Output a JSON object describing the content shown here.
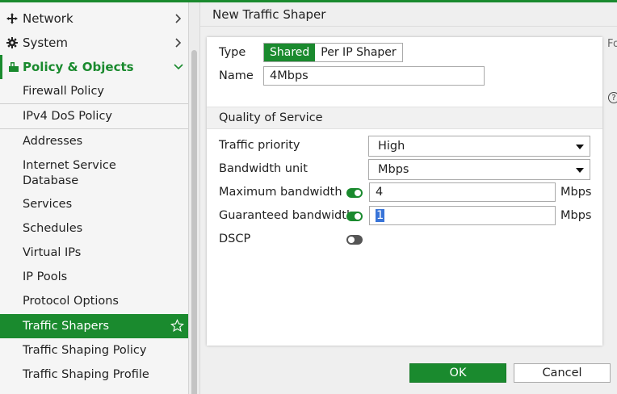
{
  "sidebar": {
    "groups": [
      {
        "label": "Network",
        "icon": "network-icon"
      },
      {
        "label": "System",
        "icon": "gear-icon"
      },
      {
        "label": "Policy & Objects",
        "icon": "policy-icon"
      }
    ],
    "items": [
      {
        "label": "Firewall Policy"
      },
      {
        "label": "IPv4 DoS Policy"
      },
      {
        "label": "Addresses"
      },
      {
        "label": "Internet Service\nDatabase"
      },
      {
        "label": "Services"
      },
      {
        "label": "Schedules"
      },
      {
        "label": "Virtual IPs"
      },
      {
        "label": "IP Pools"
      },
      {
        "label": "Protocol Options"
      },
      {
        "label": "Traffic Shapers",
        "selected": true
      },
      {
        "label": "Traffic Shaping Policy"
      },
      {
        "label": "Traffic Shaping Profile"
      }
    ]
  },
  "dialog": {
    "title": "New Traffic Shaper",
    "ok_label": "OK",
    "cancel_label": "Cancel"
  },
  "form": {
    "type_label": "Type",
    "type_options": [
      "Shared",
      "Per IP Shaper"
    ],
    "type_selected": "Shared",
    "name_label": "Name",
    "name_value": "4Mbps",
    "qos_section": "Quality of Service",
    "traffic_priority_label": "Traffic priority",
    "traffic_priority_value": "High",
    "bandwidth_unit_label": "Bandwidth unit",
    "bandwidth_unit_value": "Mbps",
    "max_bandwidth_label": "Maximum bandwidth",
    "max_bandwidth_enabled": true,
    "max_bandwidth_value": "4",
    "max_bandwidth_unit": "Mbps",
    "guaranteed_bandwidth_label": "Guaranteed bandwidth",
    "guaranteed_bandwidth_enabled": true,
    "guaranteed_bandwidth_value": "1",
    "guaranteed_bandwidth_unit": "Mbps",
    "dscp_label": "DSCP",
    "dscp_enabled": false
  },
  "side_panel": {
    "truncated_text": "Fo"
  },
  "colors": {
    "accent": "#1a8a2e",
    "selection": "#3874d8"
  }
}
